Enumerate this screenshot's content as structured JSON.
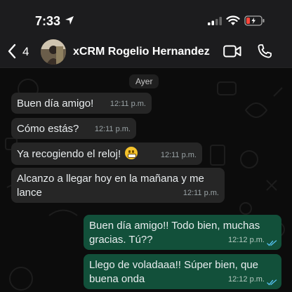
{
  "status_bar": {
    "time": "7:33",
    "icons": [
      "location-arrow-icon",
      "cellular-signal-icon",
      "wifi-icon",
      "low-battery-icon"
    ]
  },
  "header": {
    "back_count": "4",
    "contact_name": "xCRM Rogelio Hernandez",
    "icons": [
      "chevron-left-icon",
      "video-call-icon",
      "phone-call-icon"
    ]
  },
  "chat": {
    "date_label": "Ayer",
    "messages": [
      {
        "direction": "in",
        "text": "Buen día amigo!",
        "time": "12:11 p.m."
      },
      {
        "direction": "in",
        "text": "Cómo estás?",
        "time": "12:11 p.m."
      },
      {
        "direction": "in",
        "text": "Ya recogiendo el reloj!",
        "emoji": "grimacing-face-emoji",
        "time": "12:11 p.m."
      },
      {
        "direction": "in",
        "text": "Alcanzo a llegar hoy en la mañana y me lance",
        "time": "12:11 p.m."
      },
      {
        "direction": "out",
        "text": "Buen día amigo!! Todo bien, muchas gracias. Tú??",
        "time": "12:12 p.m.",
        "status": "read"
      },
      {
        "direction": "out",
        "text": "Llego de voladaaa!! Súper bien, que buena onda",
        "time": "12:12 p.m.",
        "status": "read"
      }
    ]
  },
  "colors": {
    "incoming_bubble": "#262626",
    "outgoing_bubble": "#12503a",
    "read_ticks": "#53bdeb",
    "header_bg": "#1c1c1e"
  }
}
